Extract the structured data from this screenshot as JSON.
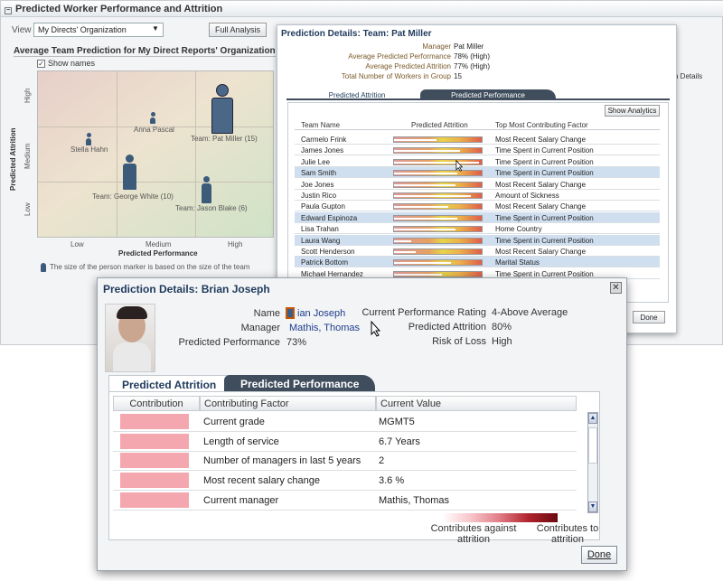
{
  "page": {
    "title": "Predicted Worker Performance and Attrition",
    "view_label": "View",
    "view_value": "My Directs' Organization",
    "full_analysis_label": "Full Analysis",
    "chart_title": "Average Team Prediction for My Direct Reports' Organization",
    "show_names_label": "Show names",
    "y_axis_label": "Predicted Attrition",
    "x_axis_label": "Predicted Performance",
    "x_ticks": [
      "Low",
      "Medium",
      "High"
    ],
    "y_ticks": [
      "High",
      "Medium",
      "Low"
    ],
    "note": "The size of the person marker is based on the size of the team",
    "markers": [
      {
        "label": "Anna Pascal"
      },
      {
        "label": "Stella Hahn"
      },
      {
        "label": "Team: Pat Miller (15)"
      },
      {
        "label": "Team: George White (10)"
      },
      {
        "label": "Team: Jason Blake (6)"
      }
    ],
    "right_strip_label": "n Details"
  },
  "dialog1": {
    "title": "Prediction Details: Team: Pat Miller",
    "fields": [
      {
        "key": "Manager",
        "value": "Pat Miller"
      },
      {
        "key": "Average Predicted Performance",
        "value": "78% (High)"
      },
      {
        "key": "Average Predicted Attrition",
        "value": "77% (High)"
      },
      {
        "key": "Total Number of Workers in Group",
        "value": "15"
      }
    ],
    "tabs": [
      "Predicted Attrition",
      "Predicted Performance"
    ],
    "show_analytics": "Show Analytics",
    "columns": [
      "Team Name",
      "Predicted Attrition",
      "Top Most Contributing Factor"
    ],
    "rows": [
      {
        "name": "Carmelo Frink",
        "fill": 0.48,
        "factor": "Most Recent Salary Change"
      },
      {
        "name": "James Jones",
        "fill": 0.75,
        "factor": "Time Spent in Current Position"
      },
      {
        "name": "Julie Lee",
        "fill": 0.97,
        "factor": "Time Spent in Current Position"
      },
      {
        "name": "Sam Smith",
        "fill": 0.72,
        "factor": "Time Spent in Current Position"
      },
      {
        "name": "Joe Jones",
        "fill": 0.7,
        "factor": "Most Recent Salary Change"
      },
      {
        "name": "Justin Rico",
        "fill": 0.88,
        "factor": "Amount of Sickness"
      },
      {
        "name": "Paula Gupton",
        "fill": 0.62,
        "factor": "Most Recent Salary Change"
      },
      {
        "name": "Edward Espinoza",
        "fill": 0.72,
        "factor": "Time Spent in Current Position"
      },
      {
        "name": "Lisa Trahan",
        "fill": 0.7,
        "factor": "Home Country"
      },
      {
        "name": "Laura Wang",
        "fill": 0.2,
        "factor": "Time Spent in Current Position"
      },
      {
        "name": "Scott Henderson",
        "fill": 0.25,
        "factor": "Most Recent Salary Change"
      },
      {
        "name": "Patrick Bottom",
        "fill": 0.65,
        "factor": "Marital Status"
      },
      {
        "name": "Michael Hernandez",
        "fill": 0.55,
        "factor": "Time Spent in Current Position"
      }
    ],
    "done_label": "Done"
  },
  "dialog2": {
    "title": "Prediction Details: Brian Joseph",
    "name_label": "Name",
    "name_value": "ian Joseph",
    "manager_label": "Manager",
    "manager_value": "Mathis, Thomas",
    "perf_label": "Predicted Performance",
    "perf_value": "73%",
    "rating_label": "Current Performance Rating",
    "rating_value": "4-Above Average",
    "attr_label": "Predicted Attrition",
    "attr_value": "80%",
    "risk_label": "Risk of Loss",
    "risk_value": "High",
    "tabs": [
      "Predicted Attrition",
      "Predicted Performance"
    ],
    "columns": [
      "Contribution",
      "Contributing Factor",
      "Current Value"
    ],
    "rows": [
      {
        "factor": "Current grade",
        "value": "MGMT5"
      },
      {
        "factor": "Length of service",
        "value": "6.7 Years"
      },
      {
        "factor": "Number of managers in last 5 years",
        "value": "2"
      },
      {
        "factor": "Most recent salary change",
        "value": "3.6 %"
      },
      {
        "factor": "Current manager",
        "value": "Mathis, Thomas"
      }
    ],
    "legend_left": "Contributes against attrition",
    "legend_right": "Contributes to attrition",
    "done_label": "Done"
  }
}
